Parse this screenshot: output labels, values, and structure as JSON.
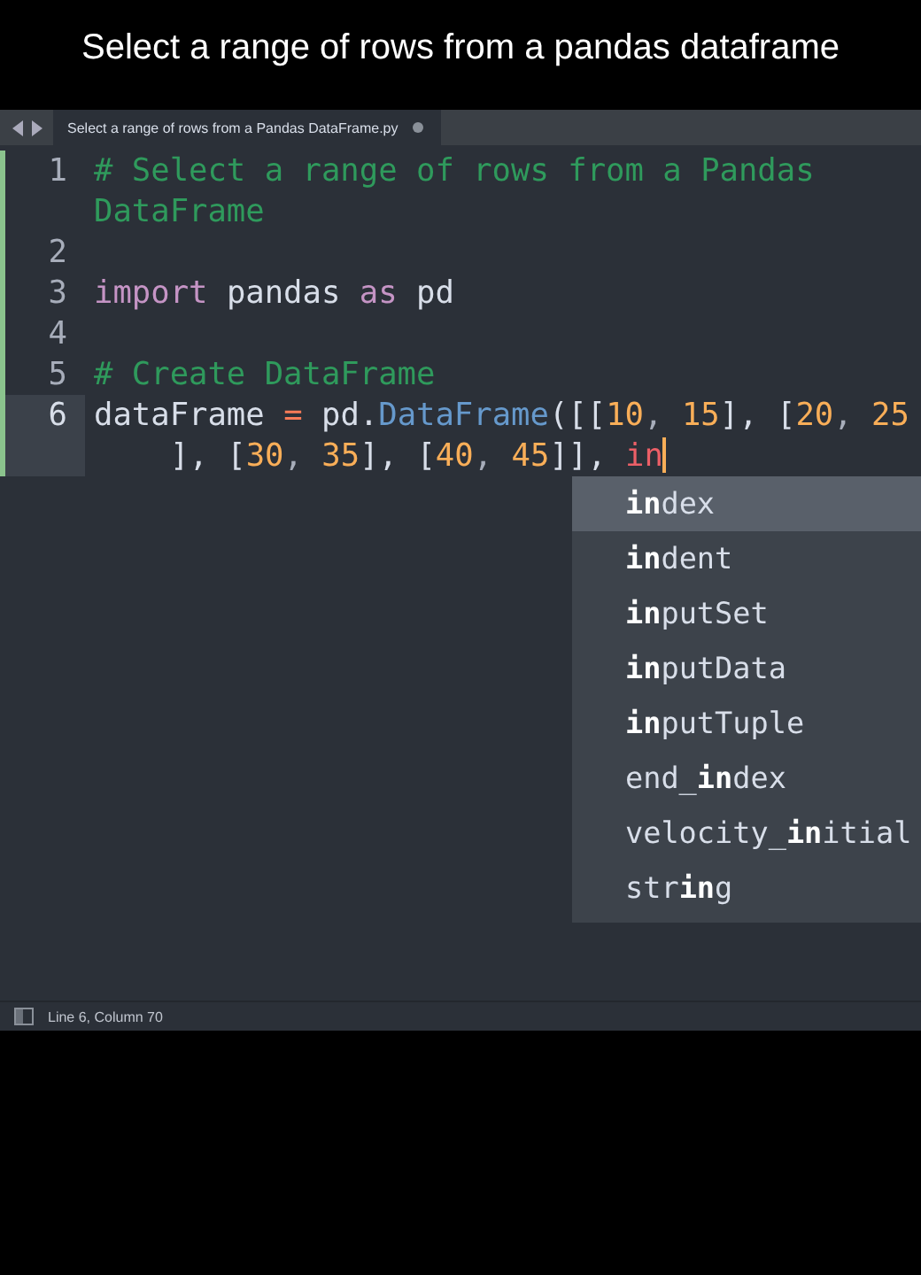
{
  "banner": {
    "title": "Select a range of rows from a pandas dataframe"
  },
  "tab": {
    "title": "Select a range of rows from a Pandas DataFrame.py",
    "dirty": true
  },
  "lines": [
    {
      "number": "1",
      "current": false,
      "modified": true,
      "rows": [
        {
          "indent": false,
          "caret": false,
          "tokens": [
            {
              "t": "# Select a range of rows from a Pandas",
              "kind": "comment"
            }
          ]
        },
        {
          "indent": false,
          "caret": false,
          "tokens": [
            {
              "t": "DataFrame",
              "kind": "comment"
            }
          ]
        }
      ]
    },
    {
      "number": "2",
      "current": false,
      "modified": true
    },
    {
      "number": "3",
      "current": false,
      "modified": true,
      "rows": [
        {
          "indent": false,
          "caret": false,
          "tokens": [
            {
              "t": "import",
              "kind": "keyword"
            },
            {
              "t": " pandas ",
              "kind": "plain"
            },
            {
              "t": "as",
              "kind": "keyword"
            },
            {
              "t": " pd",
              "kind": "plain"
            }
          ]
        }
      ]
    },
    {
      "number": "4",
      "current": false,
      "modified": true
    },
    {
      "number": "5",
      "current": false,
      "modified": true,
      "rows": [
        {
          "indent": false,
          "caret": false,
          "tokens": [
            {
              "t": "# Create DataFrame",
              "kind": "comment"
            }
          ]
        }
      ]
    },
    {
      "number": "6",
      "current": true,
      "modified": true,
      "rows": [
        {
          "indent": false,
          "caret": false,
          "tokens": [
            {
              "t": "dataFrame ",
              "kind": "plain"
            },
            {
              "t": "=",
              "kind": "operator"
            },
            {
              "t": " pd.",
              "kind": "plain"
            },
            {
              "t": "DataFrame",
              "kind": "function"
            },
            {
              "t": "([[",
              "kind": "plain"
            },
            {
              "t": "10",
              "kind": "number"
            },
            {
              "t": ", ",
              "kind": "punct"
            },
            {
              "t": "15",
              "kind": "number"
            },
            {
              "t": "], [",
              "kind": "plain"
            },
            {
              "t": "20",
              "kind": "number"
            },
            {
              "t": ", ",
              "kind": "punct"
            },
            {
              "t": "25",
              "kind": "number"
            }
          ]
        },
        {
          "indent": true,
          "caret": true,
          "tokens": [
            {
              "t": "], [",
              "kind": "plain"
            },
            {
              "t": "30",
              "kind": "number"
            },
            {
              "t": ", ",
              "kind": "punct"
            },
            {
              "t": "35",
              "kind": "number"
            },
            {
              "t": "], [",
              "kind": "plain"
            },
            {
              "t": "40",
              "kind": "number"
            },
            {
              "t": ", ",
              "kind": "punct"
            },
            {
              "t": "45",
              "kind": "number"
            },
            {
              "t": "]], ",
              "kind": "plain"
            },
            {
              "t": "in",
              "kind": "partial"
            }
          ]
        }
      ]
    }
  ],
  "completions": [
    {
      "label": "**in**dex",
      "selected": true
    },
    {
      "label": "**in**dent",
      "selected": false
    },
    {
      "label": "**in**putSet",
      "selected": false
    },
    {
      "label": "**in**putData",
      "selected": false
    },
    {
      "label": "**in**putTuple",
      "selected": false
    },
    {
      "label": "end_**in**dex",
      "selected": false
    },
    {
      "label": "velocity_**in**itial",
      "selected": false
    },
    {
      "label": "str**in**g",
      "selected": false
    }
  ],
  "status_bar": {
    "text": "Line 6, Column 70"
  }
}
